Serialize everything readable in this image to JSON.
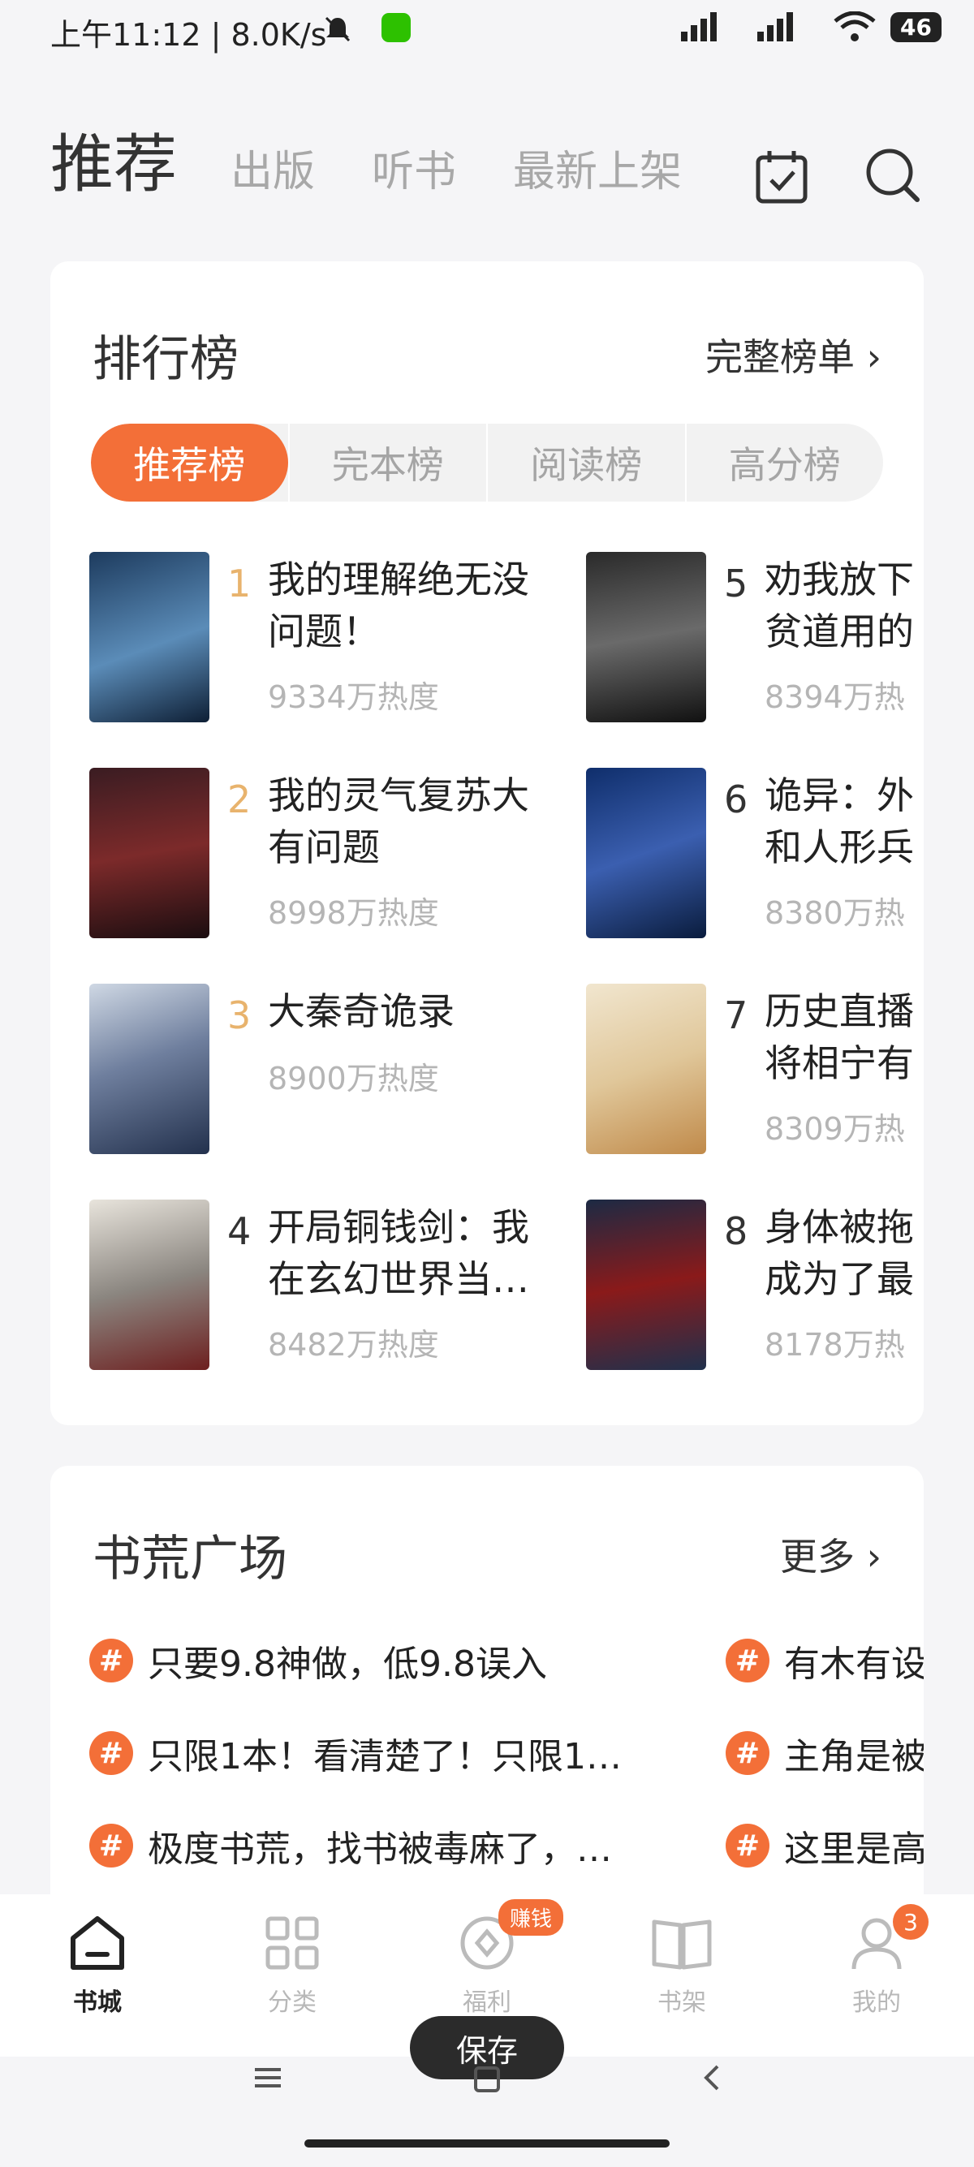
{
  "status_bar": {
    "time_speed": "上午11:12 | 8.0K/s",
    "battery": "46"
  },
  "top_tabs": {
    "active": "推荐",
    "tabs": [
      "出版",
      "听书",
      "最新上架"
    ]
  },
  "ranking": {
    "title": "排行榜",
    "full_list": "完整榜单 ›",
    "segments": [
      "推荐榜",
      "完本榜",
      "阅读榜",
      "高分榜"
    ],
    "books": [
      {
        "rank": "1",
        "title_l1": "我的理解绝无没",
        "title_l2": "问题！",
        "heat": "9334万热度"
      },
      {
        "rank": "2",
        "title_l1": "我的灵气复苏大",
        "title_l2": "有问题",
        "heat": "8998万热度"
      },
      {
        "rank": "3",
        "title_l1": "大秦奇诡录",
        "title_l2": "",
        "heat": "8900万热度"
      },
      {
        "rank": "4",
        "title_l1": "开局铜钱剑：我",
        "title_l2": "在玄幻世界当…",
        "heat": "8482万热度"
      },
      {
        "rank": "5",
        "title_l1": "劝我放下",
        "title_l2": "贫道用的",
        "heat": "8394万热"
      },
      {
        "rank": "6",
        "title_l1": "诡异：外",
        "title_l2": "和人形兵",
        "heat": "8380万热"
      },
      {
        "rank": "7",
        "title_l1": "历史直播",
        "title_l2": "将相宁有",
        "heat": "8309万热"
      },
      {
        "rank": "8",
        "title_l1": "身体被拖",
        "title_l2": "成为了最",
        "heat": "8178万热"
      }
    ]
  },
  "plaza": {
    "title": "书荒广场",
    "more": "更多 ›",
    "tags_left": [
      "只要9.8神做，低9.8误入",
      "只限1本！看清楚了！只限1…",
      "极度书荒，找书被毒麻了，…"
    ],
    "tags_right": [
      "有木有设",
      "主角是被",
      "这里是高"
    ]
  },
  "bottom_nav": {
    "items": [
      "书城",
      "分类",
      "福利",
      "书架",
      "我的"
    ],
    "earn_badge": "赚钱",
    "mine_badge": "3"
  },
  "toast": "保存"
}
